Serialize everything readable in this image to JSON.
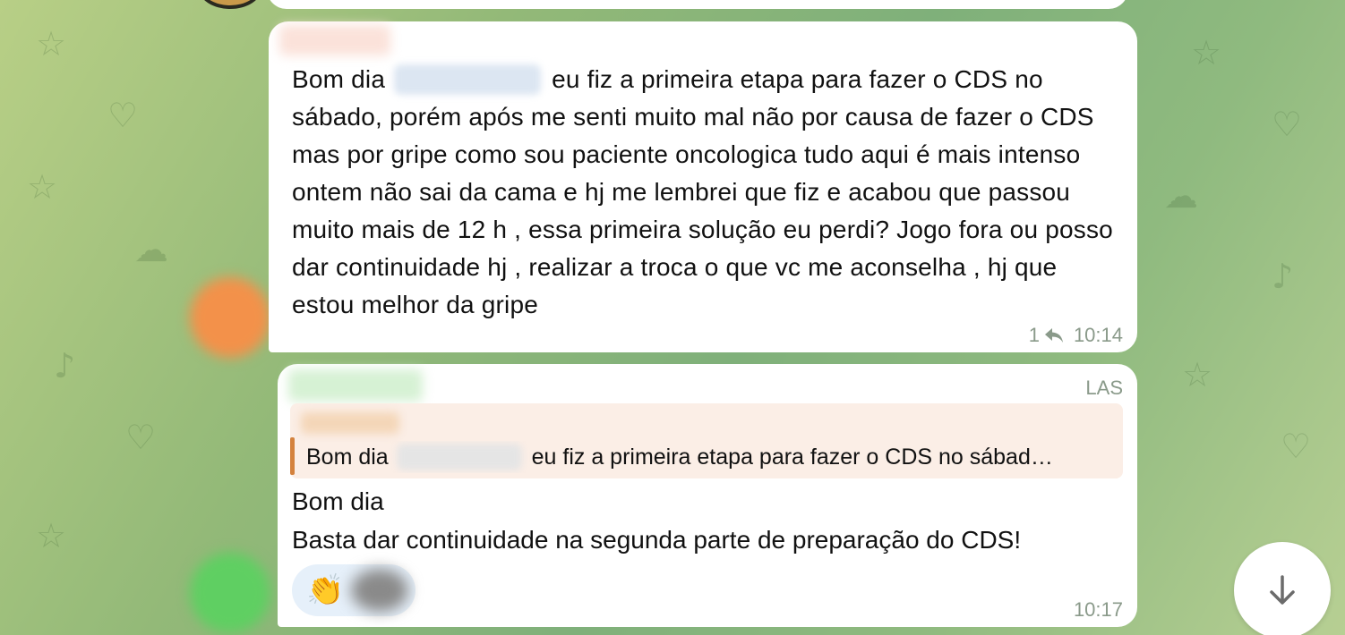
{
  "message1": {
    "sender_blurred": true,
    "text_before_name": "Bom dia ",
    "text_after_name": " eu fiz a primeira etapa para fazer o CDS no sábado, porém após me senti muito mal não por causa de fazer o CDS mas por gripe como sou paciente oncologica tudo aqui é mais intenso ontem não sai da cama e hj me lembrei que fiz e acabou que passou muito mais de 12 h , essa primeira solução eu perdi? Jogo fora ou posso dar continuidade hj , realizar  a troca o que vc me aconselha , hj que estou melhor da gripe",
    "reply_count": "1",
    "reply_icon": "reply-arrow-icon",
    "time": "10:14"
  },
  "message2": {
    "role_label": "LAS",
    "quote": {
      "text_before_name": "Bom dia ",
      "text_after_name": " eu fiz a primeira etapa para fazer o CDS no sábad…"
    },
    "line1": "Bom dia",
    "line2": "Basta dar continuidade na segunda parte de preparação do CDS!",
    "reaction": {
      "emoji": "👏",
      "icon": "clapping-hands-icon"
    },
    "time": "10:17"
  },
  "scroll_button": {
    "icon": "arrow-down-icon"
  },
  "colors": {
    "bubble": "#ffffff",
    "quote_bar": "#d4823d",
    "quote_bg": "#fbeee6",
    "meta_text": "#8a9a8a",
    "reaction_bg": "#e6f0fa"
  }
}
